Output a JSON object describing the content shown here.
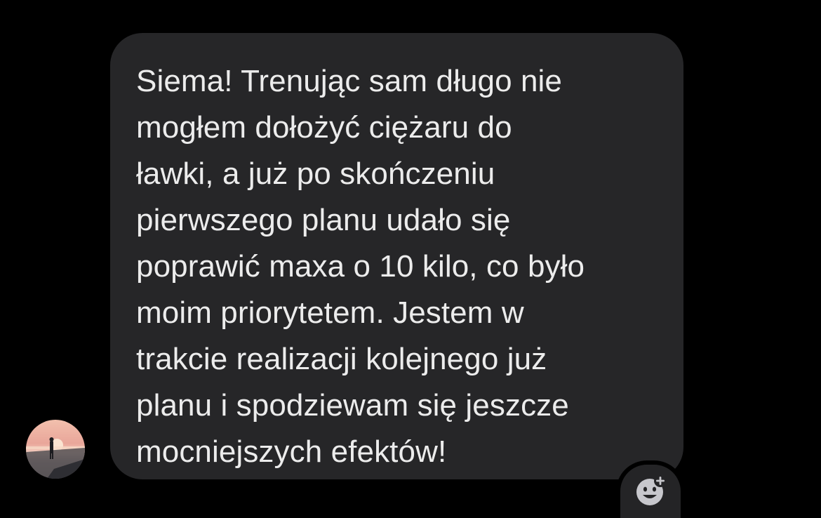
{
  "conversation": {
    "incoming_message": {
      "text": "Siema! Trenując sam długo nie\nmogłem dołożyć ciężaru do\nławki, a już po skończeniu\npierwszego planu udało się\npoprawić maxa o 10 kilo, co było\nmoim priorytetem. Jestem w\ntrakcie realizacji kolejnego już\nplanu i spodziewam się jeszcze\nmocniejszych efektów!",
      "sender_avatar": "avatar-photo-sunset-beach",
      "reaction_icon": "add-reaction-smiley-icon"
    }
  },
  "colors": {
    "background": "#000000",
    "bubble": "#262628",
    "text": "#ececec",
    "reaction_button": "#242426",
    "reaction_icon": "#c7c7cc"
  }
}
